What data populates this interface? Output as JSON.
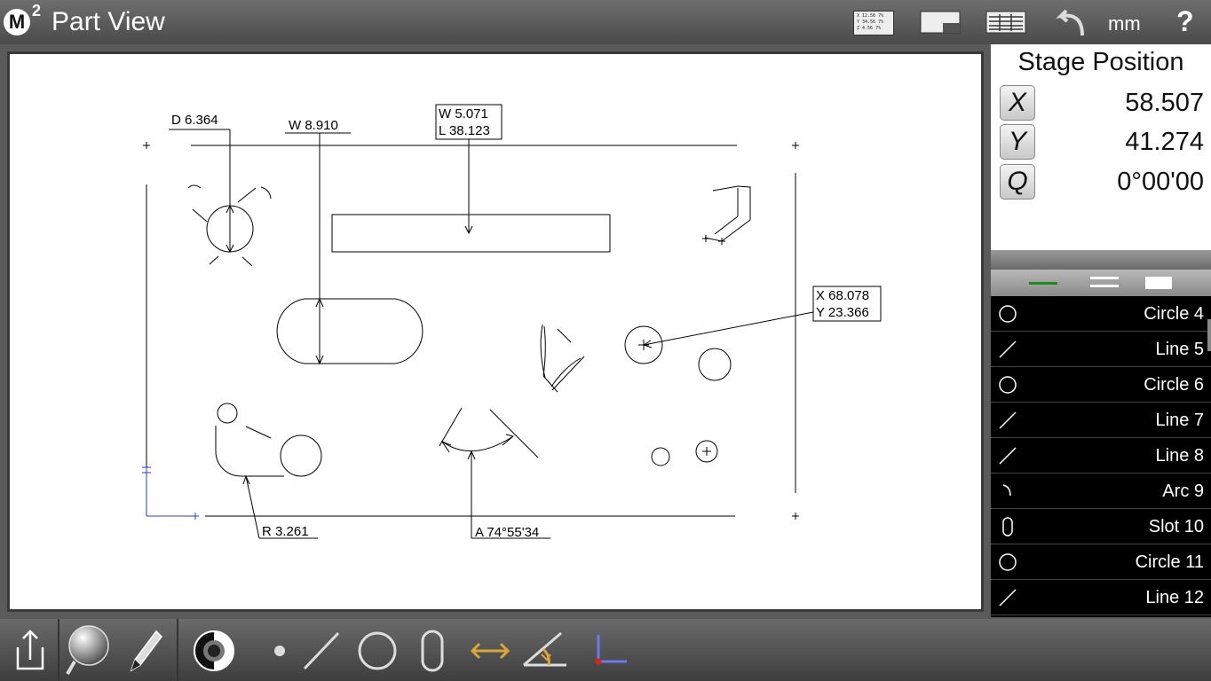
{
  "header": {
    "logo": "M",
    "logo_sup": "2",
    "title": "Part View",
    "units": "mm",
    "help": "?",
    "mini_readout": [
      "X 12.56 7%",
      "Y 34.56 7%",
      "Z 4.56 7%"
    ]
  },
  "stage": {
    "title": "Stage Position",
    "axes": [
      {
        "label": "X",
        "value": "58.507"
      },
      {
        "label": "Y",
        "value": "41.274"
      },
      {
        "label": "Q",
        "value": "0°00'00"
      }
    ]
  },
  "features": [
    {
      "label": "Circle 4",
      "icon": "circle-icon"
    },
    {
      "label": "Line 5",
      "icon": "line-icon"
    },
    {
      "label": "Circle 6",
      "icon": "circle-icon"
    },
    {
      "label": "Line 7",
      "icon": "line-icon"
    },
    {
      "label": "Line 8",
      "icon": "line-icon"
    },
    {
      "label": "Arc 9",
      "icon": "arc-icon"
    },
    {
      "label": "Slot 10",
      "icon": "slot-icon"
    },
    {
      "label": "Circle 11",
      "icon": "circle-icon"
    },
    {
      "label": "Line 12",
      "icon": "line-icon"
    }
  ],
  "dimensions": {
    "diameter": "D  6.364",
    "width": "W  8.910",
    "rect_w": "W   5.071",
    "rect_l": "L  38.123",
    "pos_x": "X  68.078",
    "pos_y": "Y  23.366",
    "radius": "R  3.261",
    "angle": "A  74°55'34"
  },
  "colors": {
    "accent_green": "#1a8a1a",
    "measure_gold": "#d9a63a",
    "axis_blue": "#2b3bd6"
  }
}
